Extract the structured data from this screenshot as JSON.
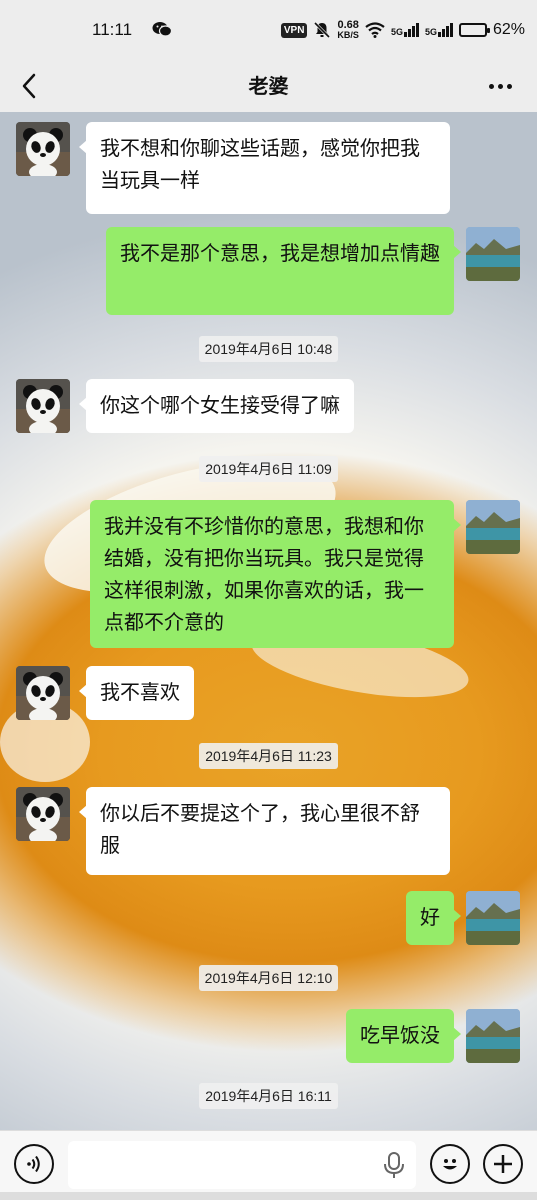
{
  "status_bar": {
    "time": "11:11",
    "wechat_icon": "wechat-icon",
    "vpn": "VPN",
    "speed_value": "0.68",
    "speed_unit": "KB/S",
    "signal_1": "5G",
    "signal_2": "5G",
    "battery": "62%",
    "battery_level": 0.62
  },
  "nav": {
    "title": "老婆",
    "back_icon": "chevron-left-icon",
    "more_icon": "more-dots-icon"
  },
  "messages": [
    {
      "side": "left",
      "text": "我不想和你聊这些话题，感觉你把我当玩具一样"
    },
    {
      "side": "right",
      "text": "我不是那个意思，我是想增加点情趣"
    },
    {
      "timestamp": "2019年4月6日 10:48"
    },
    {
      "side": "left",
      "text": "你这个哪个女生接受得了嘛"
    },
    {
      "timestamp": "2019年4月6日 11:09"
    },
    {
      "side": "right",
      "text": "我并没有不珍惜你的意思，我想和你结婚，没有把你当玩具。我只是觉得这样很刺激，如果你喜欢的话，我一点都不介意的"
    },
    {
      "side": "left",
      "text": "我不喜欢"
    },
    {
      "timestamp": "2019年4月6日 11:23"
    },
    {
      "side": "left",
      "text": "你以后不要提这个了，我心里很不舒服"
    },
    {
      "side": "right",
      "text": "好"
    },
    {
      "timestamp": "2019年4月6日 12:10"
    },
    {
      "side": "right",
      "text": "吃早饭没"
    },
    {
      "timestamp": "2019年4月6日 16:11"
    }
  ],
  "input_bar": {
    "voice_icon": "voice-icon",
    "mic_icon": "microphone-icon",
    "emoji_icon": "emoji-icon",
    "plus_icon": "plus-icon",
    "value": ""
  },
  "colors": {
    "sent_bubble": "#95ec69",
    "received_bubble": "#ffffff",
    "background": "#ededed"
  }
}
